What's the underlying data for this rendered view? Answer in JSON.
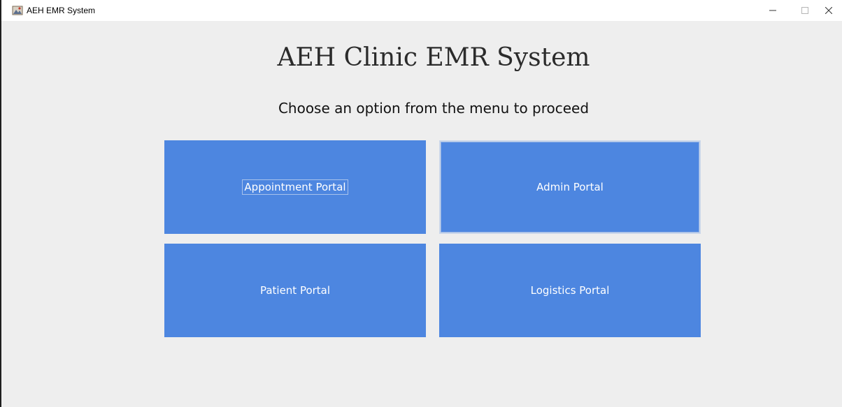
{
  "window": {
    "title": "AEH EMR System",
    "icon": "java-app-icon",
    "controls": [
      "minimize",
      "maximize",
      "close"
    ]
  },
  "main": {
    "heading": "AEH Clinic EMR System",
    "subheading": "Choose an option from the menu to proceed",
    "buttons": [
      {
        "label": "Appointment Portal",
        "focused": true
      },
      {
        "label": "Admin Portal",
        "focused": false
      },
      {
        "label": "Patient Portal",
        "focused": false
      },
      {
        "label": "Logistics Portal",
        "focused": false
      }
    ]
  },
  "colors": {
    "button_bg": "#4d86e0",
    "button_text": "#ffffff",
    "window_bg": "#eeeeee"
  }
}
